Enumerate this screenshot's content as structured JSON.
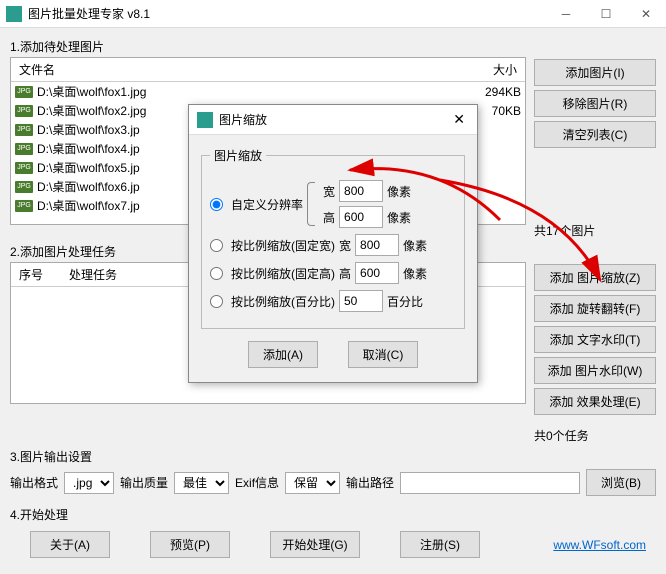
{
  "title": "图片批量处理专家 v8.1",
  "section1": {
    "label": "1.添加待处理图片",
    "cols": {
      "name": "文件名",
      "size": "大小"
    },
    "files": [
      {
        "name": "D:\\桌面\\wolf\\fox1.jpg",
        "size": "294KB"
      },
      {
        "name": "D:\\桌面\\wolf\\fox2.jpg",
        "size": "70KB"
      },
      {
        "name": "D:\\桌面\\wolf\\fox3.jp",
        "size": ""
      },
      {
        "name": "D:\\桌面\\wolf\\fox4.jp",
        "size": ""
      },
      {
        "name": "D:\\桌面\\wolf\\fox5.jp",
        "size": ""
      },
      {
        "name": "D:\\桌面\\wolf\\fox6.jp",
        "size": ""
      },
      {
        "name": "D:\\桌面\\wolf\\fox7.jp",
        "size": ""
      }
    ],
    "btns": {
      "add": "添加图片(I)",
      "remove": "移除图片(R)",
      "clear": "清空列表(C)"
    },
    "count": "共17个图片"
  },
  "section2": {
    "label": "2.添加图片处理任务",
    "cols": {
      "no": "序号",
      "task": "处理任务"
    },
    "btns": {
      "zoom": "添加 图片缩放(Z)",
      "rotate": "添加 旋转翻转(F)",
      "text": "添加 文字水印(T)",
      "img": "添加 图片水印(W)",
      "effect": "添加 效果处理(E)"
    },
    "count": "共0个任务"
  },
  "section3": {
    "label": "3.图片输出设置",
    "format_label": "输出格式",
    "format_val": ".jpg",
    "quality_label": "输出质量",
    "quality_val": "最佳",
    "exif_label": "Exif信息",
    "exif_val": "保留",
    "path_label": "输出路径",
    "browse": "浏览(B)"
  },
  "section4": {
    "label": "4.开始处理",
    "about": "关于(A)",
    "preview": "预览(P)",
    "start": "开始处理(G)",
    "register": "注册(S)",
    "url": "www.WFsoft.com"
  },
  "dialog": {
    "title": "图片缩放",
    "legend": "图片缩放",
    "opt1": "自定义分辨率",
    "w_label": "宽",
    "w_val": "800",
    "w_unit": "像素",
    "h_label": "高",
    "h_val": "600",
    "h_unit": "像素",
    "opt2": "按比例缩放(固定宽)",
    "opt2_lbl": "宽",
    "opt2_val": "800",
    "opt2_unit": "像素",
    "opt3": "按比例缩放(固定高)",
    "opt3_lbl": "高",
    "opt3_val": "600",
    "opt3_unit": "像素",
    "opt4": "按比例缩放(百分比)",
    "opt4_val": "50",
    "opt4_unit": "百分比",
    "add": "添加(A)",
    "cancel": "取消(C)"
  }
}
